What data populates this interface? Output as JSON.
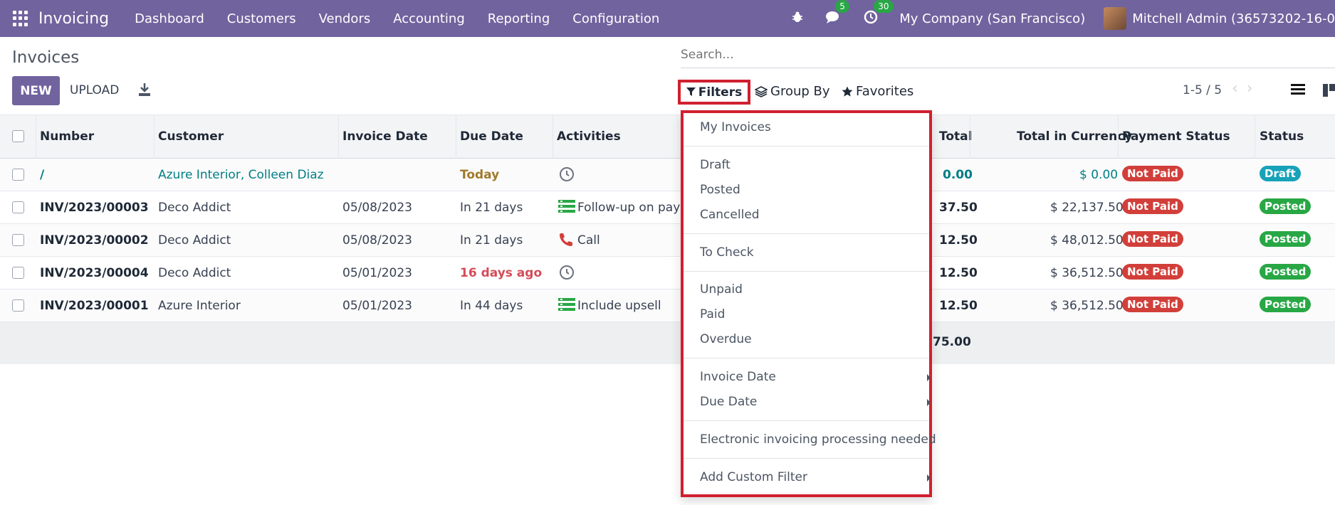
{
  "topbar": {
    "app_name": "Invoicing",
    "nav": [
      "Dashboard",
      "Customers",
      "Vendors",
      "Accounting",
      "Reporting",
      "Configuration"
    ],
    "messages_count": "5",
    "activities_count": "30",
    "company": "My Company (San Francisco)",
    "user": "Mitchell Admin (36573202-16-0"
  },
  "control": {
    "title": "Invoices",
    "new_label": "NEW",
    "upload_label": "UPLOAD",
    "search_placeholder": "Search...",
    "filters_label": "Filters",
    "groupby_label": "Group By",
    "favorites_label": "Favorites",
    "pager": "1-5 / 5"
  },
  "table": {
    "headers": {
      "number": "Number",
      "customer": "Customer",
      "invoice_date": "Invoice Date",
      "due_date": "Due Date",
      "activities": "Activities",
      "total": "Total",
      "total_currency": "Total in Currency",
      "payment_status": "Payment Status",
      "status": "Status"
    },
    "rows": [
      {
        "number": "/",
        "customer": "Azure Interior, Colleen Diaz",
        "invoice_date": "",
        "due_date": "Today",
        "activity": "",
        "total": "0.00",
        "total_currency": "$ 0.00",
        "payment_status": "Not Paid",
        "status": "Draft"
      },
      {
        "number": "INV/2023/00003",
        "customer": "Deco Addict",
        "invoice_date": "05/08/2023",
        "due_date": "In 21 days",
        "activity": "Follow-up on payr",
        "total": "37.50",
        "total_currency": "$ 22,137.50",
        "payment_status": "Not Paid",
        "status": "Posted"
      },
      {
        "number": "INV/2023/00002",
        "customer": "Deco Addict",
        "invoice_date": "05/08/2023",
        "due_date": "In 21 days",
        "activity": "Call",
        "total": "12.50",
        "total_currency": "$ 48,012.50",
        "payment_status": "Not Paid",
        "status": "Posted"
      },
      {
        "number": "INV/2023/00004",
        "customer": "Deco Addict",
        "invoice_date": "05/01/2023",
        "due_date": "16 days ago",
        "activity": "",
        "total": "12.50",
        "total_currency": "$ 36,512.50",
        "payment_status": "Not Paid",
        "status": "Posted"
      },
      {
        "number": "INV/2023/00001",
        "customer": "Azure Interior",
        "invoice_date": "05/01/2023",
        "due_date": "In 44 days",
        "activity": "Include upsell",
        "total": "12.50",
        "total_currency": "$ 36,512.50",
        "payment_status": "Not Paid",
        "status": "Posted"
      }
    ],
    "footer_total": "75.00"
  },
  "filters_menu": {
    "my_invoices": "My Invoices",
    "draft": "Draft",
    "posted": "Posted",
    "cancelled": "Cancelled",
    "to_check": "To Check",
    "unpaid": "Unpaid",
    "paid": "Paid",
    "overdue": "Overdue",
    "invoice_date": "Invoice Date",
    "due_date": "Due Date",
    "electronic": "Electronic invoicing processing needed",
    "add_custom": "Add Custom Filter"
  },
  "colors": {
    "brand": "#71639e",
    "highlight": "#d0202f",
    "not_paid": "#d23f3a",
    "posted": "#28a745",
    "draft": "#17a2b8",
    "link": "#017e84"
  }
}
